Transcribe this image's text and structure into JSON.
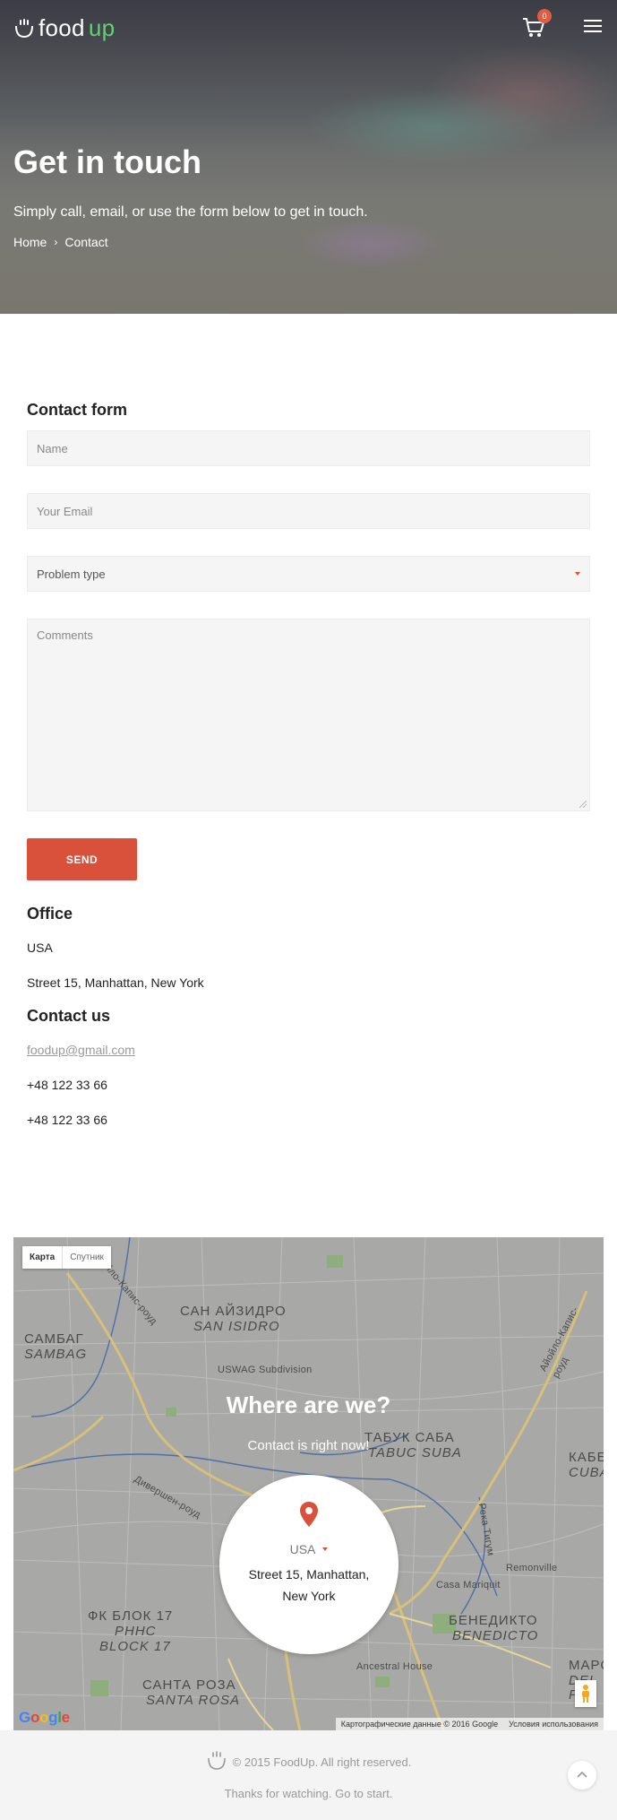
{
  "header": {
    "logo_text_a": "food",
    "logo_text_b": "up",
    "cart_count": "0",
    "title": "Get in touch",
    "subtitle": "Simply call, email, or use the form below to get in touch.",
    "breadcrumb": {
      "home": "Home",
      "separator": "›",
      "current": "Contact"
    }
  },
  "form": {
    "title": "Contact form",
    "name_placeholder": "Name",
    "email_placeholder": "Your Email",
    "problem_selected": "Problem type",
    "comments_placeholder": "Comments",
    "send_label": "SEND"
  },
  "office": {
    "title": "Office",
    "country": "USA",
    "address": "Street 15, Manhattan, New York"
  },
  "contact": {
    "title": "Contact us",
    "email": "foodup@gmail.com",
    "phone_1": "+48 122 33 66",
    "phone_2": "+48 122 33 66"
  },
  "map": {
    "type_map": "Карта",
    "type_satellite": "Спутник",
    "overlay_title": "Where are we?",
    "overlay_sub": "Contact is right now!",
    "country": "USA",
    "address_line1": "Street 15, Manhattan,",
    "address_line2": "New York",
    "google": [
      "G",
      "o",
      "o",
      "g",
      "l",
      "e"
    ],
    "attribution": "Картографические данные © 2016 Google",
    "terms": "Условия использования",
    "labels": {
      "san_isidro_ru": "САН АЙЗИДРО",
      "san_isidro": "SAN ISIDRO",
      "sambag_ru": "САМБАГ",
      "sambag": "SAMBAG",
      "uswag": "USWAG Subdivision",
      "tabuk_ru": "ТАБУК САБА",
      "tabuk": "TABUC SUBA",
      "casa": "Casa Mariquit",
      "remonville": "Remonville",
      "benedicto_ru": "БЕНЕДИКТО",
      "benedicto": "BENEDICTO",
      "ancestral": "Ancestral House",
      "block17_ru": "ФК БЛОК 17",
      "block17_b": "РННС",
      "block17": "BLOCK 17",
      "santa_rosa_ru": "САНТА РОЗА",
      "santa_rosa": "SANTA ROSA",
      "diversion": "Дивершен-роуд",
      "road_left": "Айойло-Капис-роуд",
      "road_right": "Айойло-Капис-роуд",
      "river": "Река Тигум",
      "kabe": "КАБЕ",
      "cuba": "CUBA",
      "marce": "МАРСЕ",
      "del": "DEL P"
    }
  },
  "footer": {
    "copyright": "© 2015 FoodUp. All right reserved.",
    "note": "Thanks for watching. Go to start."
  },
  "colors": {
    "accent": "#d9513b",
    "logo_green": "#5fd36d",
    "field_bg": "#f5f5f5",
    "footer_bg": "#f4f4f4"
  },
  "icons": {
    "logo": "cup-steam-icon",
    "cart": "cart-icon",
    "menu": "hamburger-icon",
    "breadcrumb_sep": "chevron-right-icon",
    "select": "caret-down-icon",
    "map_pin": "map-pin-icon",
    "pegman": "pegman-icon",
    "to_top": "chevron-up-icon"
  }
}
